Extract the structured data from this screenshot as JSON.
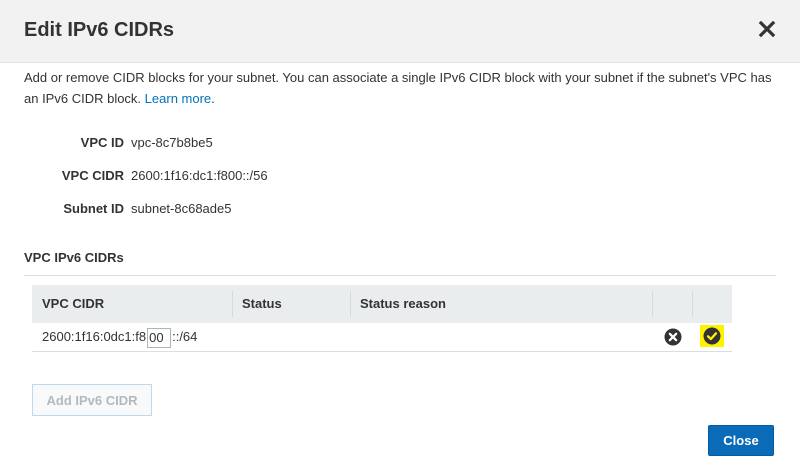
{
  "dialog": {
    "title": "Edit IPv6 CIDRs",
    "close_icon": "close-x-icon"
  },
  "intro": {
    "text": "Add or remove CIDR blocks for your subnet. You can associate a single IPv6 CIDR block with your subnet if the subnet's VPC has an IPv6 CIDR block.",
    "link_text": "Learn more",
    "suffix": "."
  },
  "details": [
    {
      "label": "VPC ID",
      "value": "vpc-8c7b8be5"
    },
    {
      "label": "VPC CIDR",
      "value": "2600:1f16:dc1:f800::/56"
    },
    {
      "label": "Subnet ID",
      "value": "subnet-8c68ade5"
    }
  ],
  "section": {
    "title": "VPC IPv6 CIDRs"
  },
  "table": {
    "headers": [
      "VPC CIDR",
      "Status",
      "Status reason"
    ],
    "rows": [
      {
        "cidr_prefix": "2600:1f16:0dc1:f8",
        "cidr_input_value": "00",
        "cidr_suffix": "::/64",
        "status": "",
        "status_reason": "",
        "remove_icon": "remove-circle-icon",
        "confirm_icon": "confirm-check-icon"
      }
    ]
  },
  "buttons": {
    "add_label": "Add IPv6 CIDR",
    "close_label": "Close"
  },
  "colors": {
    "accent": "#0a6bb8",
    "link": "#0073bb",
    "highlight": "#fff200",
    "header_bg": "#f2f2f2",
    "table_head_bg": "#eaeded"
  }
}
